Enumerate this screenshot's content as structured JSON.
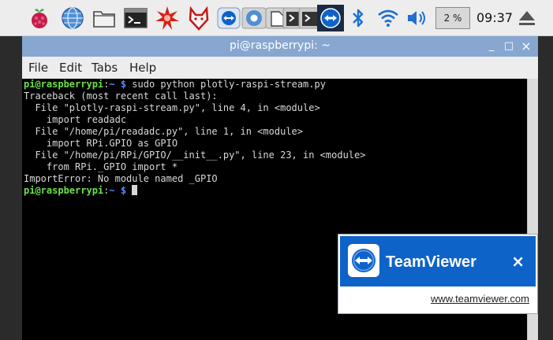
{
  "panel": {
    "launchers": [
      {
        "icon": "raspberry-menu-icon"
      },
      {
        "icon": "web-browser-globe-icon"
      },
      {
        "icon": "file-manager-folder-icon"
      },
      {
        "icon": "terminal-icon"
      },
      {
        "icon": "math-kernel-burst-icon"
      },
      {
        "icon": "wolfram-wolf-icon"
      },
      {
        "icon": "teamviewer-taskbar-icon"
      },
      {
        "icon": "chromium-taskbar-icon"
      },
      {
        "icon": "file-manager-taskbar-icon"
      },
      {
        "icon": "terminal-taskbar-icon"
      },
      {
        "icon": "terminal-taskbar-icon-2"
      },
      {
        "icon": "teamviewer-active-taskbar-icon"
      }
    ],
    "tray": {
      "bluetooth_icon": "bluetooth-icon",
      "wifi_icon": "wifi-icon",
      "volume_icon": "volume-icon",
      "cpu_label": "2 %",
      "clock": "09:37",
      "eject_icon": "eject-icon"
    }
  },
  "window": {
    "title": "pi@raspberrypi: ~",
    "minimize": "_",
    "maximize": "□",
    "close": "×",
    "menus": [
      "File",
      "Edit",
      "Tabs",
      "Help"
    ]
  },
  "terminal": {
    "prompt_user": "pi@raspberrypi",
    "prompt_sep": ":",
    "prompt_path": "~ $",
    "command": " sudo python plotly-raspi-stream.py",
    "output": [
      "Traceback (most recent call last):",
      "  File \"plotly-raspi-stream.py\", line 4, in <module>",
      "    import readadc",
      "  File \"/home/pi/readadc.py\", line 1, in <module>",
      "    import RPi.GPIO as GPIO",
      "  File \"/home/pi/RPi/GPIO/__init__.py\", line 23, in <module>",
      "    from RPi._GPIO import *",
      "ImportError: No module named _GPIO"
    ]
  },
  "teamviewer": {
    "name": "TeamViewer",
    "close": "×",
    "link": "www.teamviewer.com"
  }
}
